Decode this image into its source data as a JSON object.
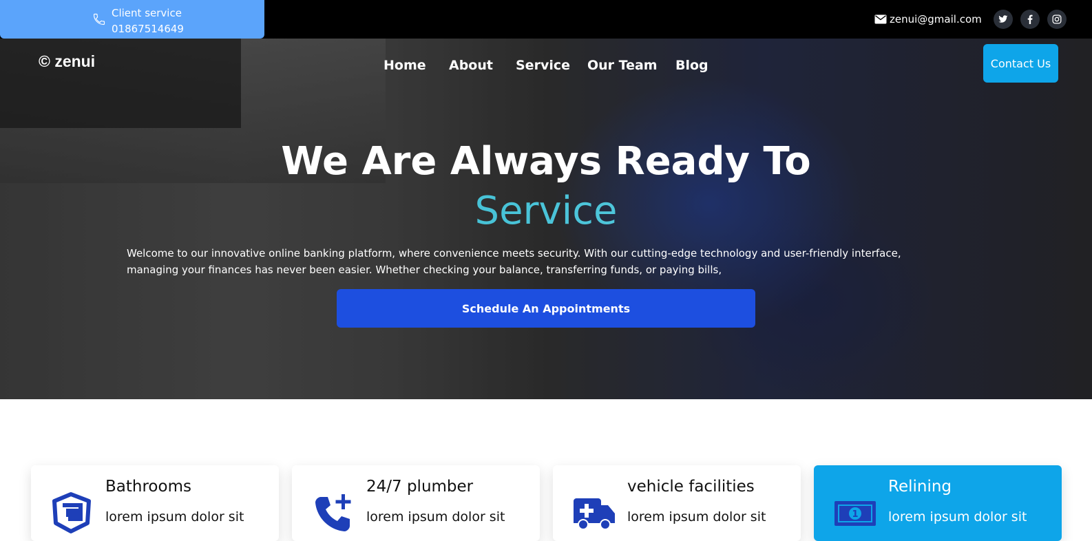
{
  "topbar": {
    "client_label": "Client service",
    "client_number": "01867514649",
    "email": "zenui@gmail.com",
    "social_icons": [
      "twitter-icon",
      "facebook-icon",
      "instagram-icon"
    ]
  },
  "header": {
    "brand": "© zenui",
    "nav": [
      "Home",
      "About",
      "Service",
      "Our Team",
      "Blog"
    ],
    "contact_label": "Contact Us"
  },
  "hero": {
    "headline": "We Are Always Ready To",
    "accent": "Service",
    "intro": "Welcome to our innovative online banking platform, where convenience meets security. With our cutting-edge technology and user-friendly interface, managing your finances has never been easier. Whether checking your balance, transferring funds, or paying bills,",
    "cta_label": "Schedule An Appointments"
  },
  "services": [
    {
      "title": "Bathrooms",
      "desc": "lorem ipsum dolor sit",
      "icon": "bathroom-shield-icon"
    },
    {
      "title": "24/7 plumber",
      "desc": "lorem ipsum dolor sit",
      "icon": "phone-plus-icon"
    },
    {
      "title": "vehicle facilities",
      "desc": "lorem ipsum dolor sit",
      "icon": "ambulance-icon"
    },
    {
      "title": "Relining",
      "desc": "lorem ipsum dolor sit",
      "icon": "money-bill-icon"
    }
  ],
  "colors": {
    "accent_blue": "#0ea5e9",
    "client_box": "#5ba4fb",
    "cta_blue": "#1d4fe0",
    "icon_blue": "#1e3fb8",
    "accent_teal": "#45c3da"
  }
}
